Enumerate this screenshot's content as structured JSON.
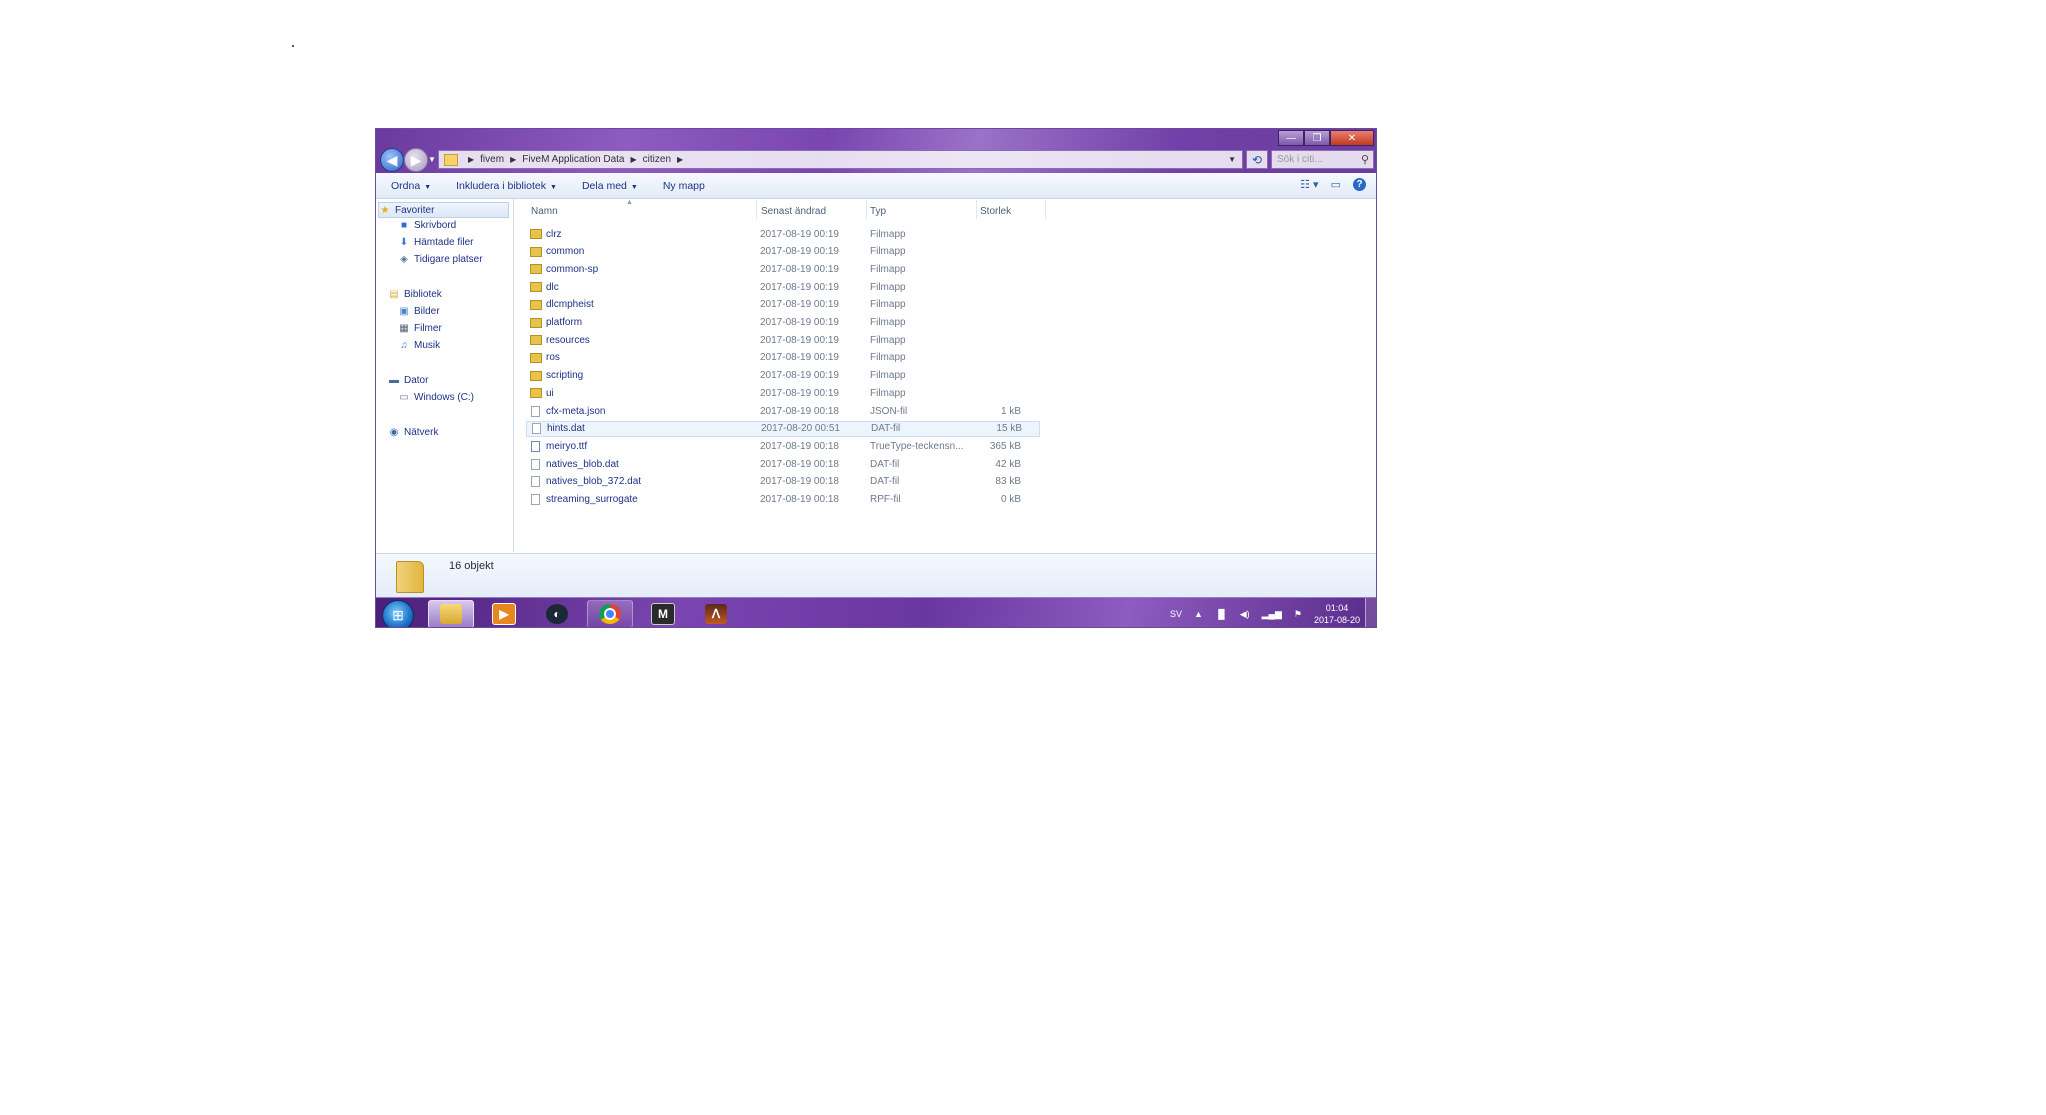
{
  "window": {
    "caption_buttons": {
      "minimize": "—",
      "maximize": "❐",
      "close": "✕"
    },
    "address": {
      "crumbs": [
        "fivem",
        "FiveM Application Data",
        "citizen"
      ]
    },
    "search": {
      "placeholder": "Sök i citi..."
    }
  },
  "toolbar": {
    "organize": "Ordna",
    "include_library": "Inkludera i bibliotek",
    "share": "Dela med",
    "new_folder": "Ny mapp"
  },
  "nav": {
    "favorites": "Favoriter",
    "desktop": "Skrivbord",
    "downloads": "Hämtade filer",
    "recent": "Tidigare platser",
    "libraries": "Bibliotek",
    "pictures": "Bilder",
    "videos": "Filmer",
    "music": "Musik",
    "computer": "Dator",
    "drive_c": "Windows (C:)",
    "network": "Nätverk"
  },
  "columns": {
    "name": "Namn",
    "modified": "Senast ändrad",
    "type": "Typ",
    "size": "Storlek"
  },
  "files": [
    {
      "name": "clrz",
      "modified": "2017-08-19 00:19",
      "type": "Filmapp",
      "size": "",
      "kind": "folder"
    },
    {
      "name": "common",
      "modified": "2017-08-19 00:19",
      "type": "Filmapp",
      "size": "",
      "kind": "folder"
    },
    {
      "name": "common-sp",
      "modified": "2017-08-19 00:19",
      "type": "Filmapp",
      "size": "",
      "kind": "folder"
    },
    {
      "name": "dlc",
      "modified": "2017-08-19 00:19",
      "type": "Filmapp",
      "size": "",
      "kind": "folder"
    },
    {
      "name": "dlcmpheist",
      "modified": "2017-08-19 00:19",
      "type": "Filmapp",
      "size": "",
      "kind": "folder"
    },
    {
      "name": "platform",
      "modified": "2017-08-19 00:19",
      "type": "Filmapp",
      "size": "",
      "kind": "folder"
    },
    {
      "name": "resources",
      "modified": "2017-08-19 00:19",
      "type": "Filmapp",
      "size": "",
      "kind": "folder"
    },
    {
      "name": "ros",
      "modified": "2017-08-19 00:19",
      "type": "Filmapp",
      "size": "",
      "kind": "folder"
    },
    {
      "name": "scripting",
      "modified": "2017-08-19 00:19",
      "type": "Filmapp",
      "size": "",
      "kind": "folder"
    },
    {
      "name": "ui",
      "modified": "2017-08-19 00:19",
      "type": "Filmapp",
      "size": "",
      "kind": "folder"
    },
    {
      "name": "cfx-meta.json",
      "modified": "2017-08-19 00:18",
      "type": "JSON-fil",
      "size": "1 kB",
      "kind": "file"
    },
    {
      "name": "hints.dat",
      "modified": "2017-08-20 00:51",
      "type": "DAT-fil",
      "size": "15 kB",
      "kind": "file"
    },
    {
      "name": "meiryo.ttf",
      "modified": "2017-08-19 00:18",
      "type": "TrueType-teckensn...",
      "size": "365 kB",
      "kind": "font"
    },
    {
      "name": "natives_blob.dat",
      "modified": "2017-08-19 00:18",
      "type": "DAT-fil",
      "size": "42 kB",
      "kind": "file"
    },
    {
      "name": "natives_blob_372.dat",
      "modified": "2017-08-19 00:18",
      "type": "DAT-fil",
      "size": "83 kB",
      "kind": "file"
    },
    {
      "name": "streaming_surrogate",
      "modified": "2017-08-19 00:18",
      "type": "RPF-fil",
      "size": "0 kB",
      "kind": "file"
    }
  ],
  "details": {
    "count": "16 objekt"
  },
  "taskbar": {
    "language": "SV",
    "time": "01:04",
    "date": "2017-08-20"
  }
}
